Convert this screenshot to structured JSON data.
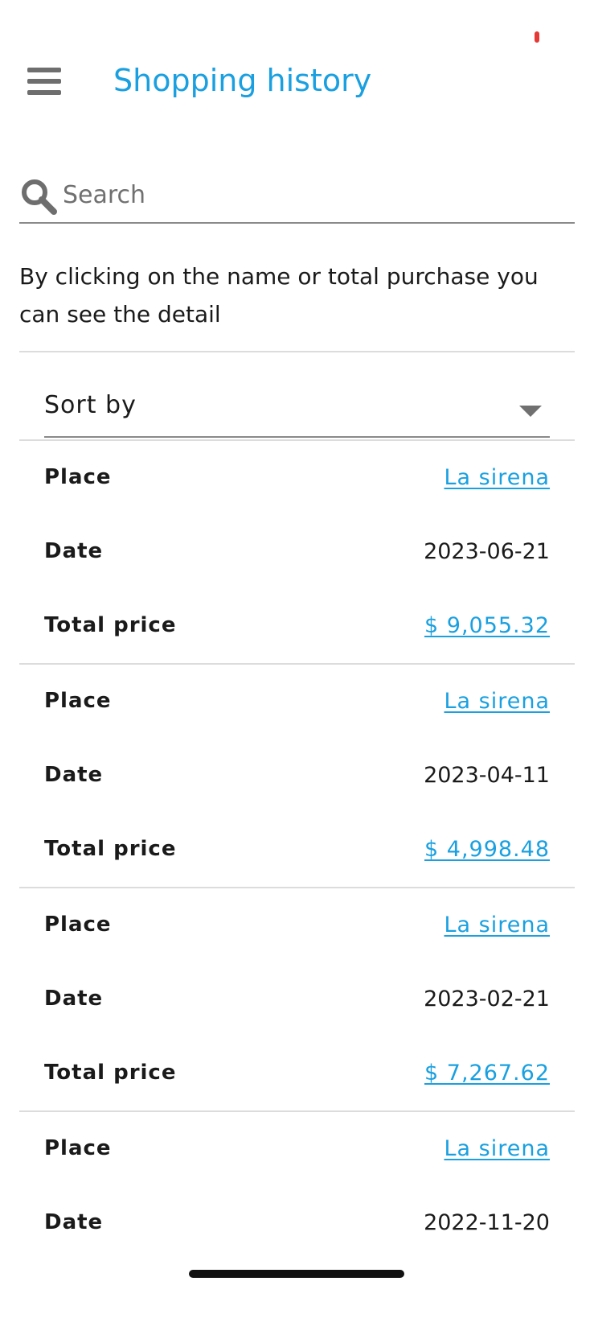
{
  "status": {
    "indicator_color": "#e53935"
  },
  "app_bar": {
    "menu_icon": "hamburger-menu-icon",
    "title": "Shopping history",
    "title_color": "#1aa0e0"
  },
  "search": {
    "icon": "search-icon",
    "placeholder": "Search",
    "value": ""
  },
  "hint_text": "By clicking on the name or total purchase you can see the detail",
  "sort": {
    "label": "Sort by",
    "icon": "caret-down-icon"
  },
  "field_labels": {
    "place": "Place",
    "date": "Date",
    "total_price": "Total price"
  },
  "records": [
    {
      "place": "La sirena",
      "date": "2023-06-21",
      "total_price": "$ 9,055.32"
    },
    {
      "place": "La sirena",
      "date": "2023-04-11",
      "total_price": "$ 4,998.48"
    },
    {
      "place": "La sirena",
      "date": "2023-02-21",
      "total_price": "$ 7,267.62"
    },
    {
      "place": "La sirena",
      "date": "2022-11-20",
      "total_price": ""
    }
  ],
  "colors": {
    "accent": "#1aa0e0",
    "divider": "#dcdcdc",
    "icon_gray": "#6e6e6e"
  }
}
